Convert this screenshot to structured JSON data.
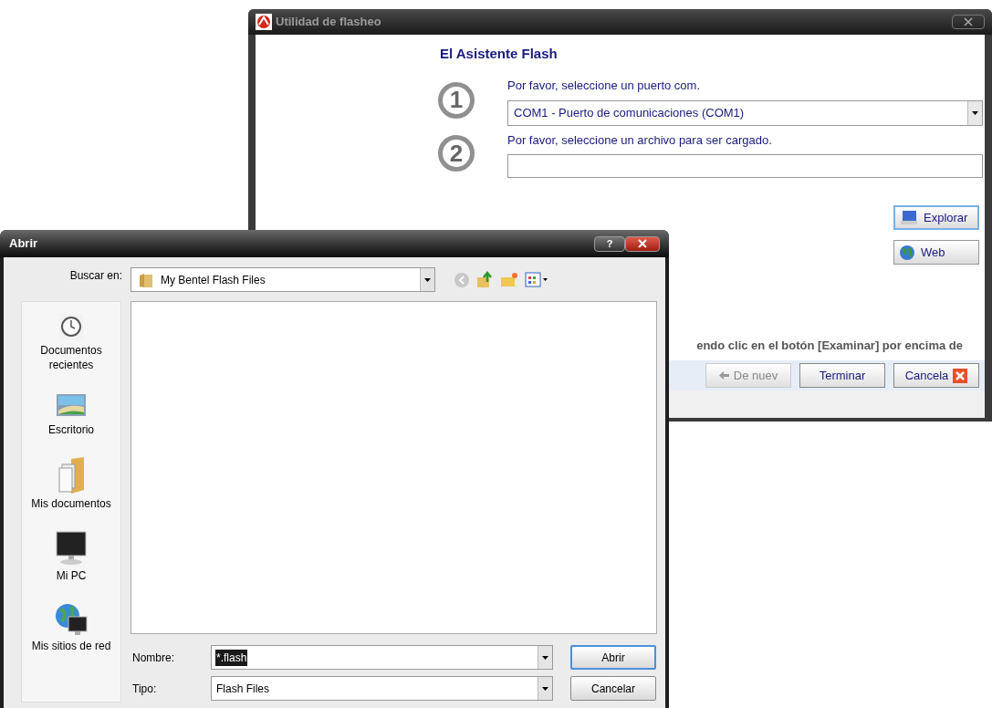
{
  "flash_window": {
    "title": "Utilidad de flasheo",
    "heading": "El Asistente Flash",
    "steps": [
      {
        "number": "1",
        "prompt": "Por favor, seleccione un puerto com.",
        "kind": "dropdown",
        "value": "COM1 - Puerto de comunicaciones (COM1)"
      },
      {
        "number": "2",
        "prompt": "Por favor, seleccione un archivo para ser cargado.",
        "kind": "text"
      }
    ],
    "side_buttons": [
      {
        "label": "Explorar",
        "kind": "computer",
        "focused": true
      },
      {
        "label": "Web",
        "kind": "globe",
        "focused": false
      }
    ],
    "instruction": "endo clic en el botón [Examinar] por encima de",
    "nav_buttons": [
      {
        "label": "De nuev",
        "kind": "back",
        "disabled": true
      },
      {
        "label": "Terminar",
        "kind": "plain",
        "disabled": false
      },
      {
        "label": "Cancela",
        "kind": "cancel",
        "disabled": false
      }
    ]
  },
  "open_dialog": {
    "title": "Abrir",
    "help": "?",
    "look_in_label": "Buscar en:",
    "look_in_value": "My Bentel Flash Files",
    "places": [
      {
        "label": "Documentos recientes",
        "kind": "recent"
      },
      {
        "label": "Escritorio",
        "kind": "desktop"
      },
      {
        "label": "Mis documentos",
        "kind": "documents"
      },
      {
        "label": "Mi PC",
        "kind": "computer"
      },
      {
        "label": "Mis sitios de red",
        "kind": "network"
      }
    ],
    "fields": [
      {
        "label": "Nombre:",
        "value": "*.flash",
        "value_selected": true
      },
      {
        "label": "Tipo:",
        "value": "Flash Files",
        "value_selected": false
      }
    ],
    "buttons": [
      {
        "label": "Abrir",
        "default": true
      },
      {
        "label": "Cancelar",
        "default": false
      }
    ]
  }
}
